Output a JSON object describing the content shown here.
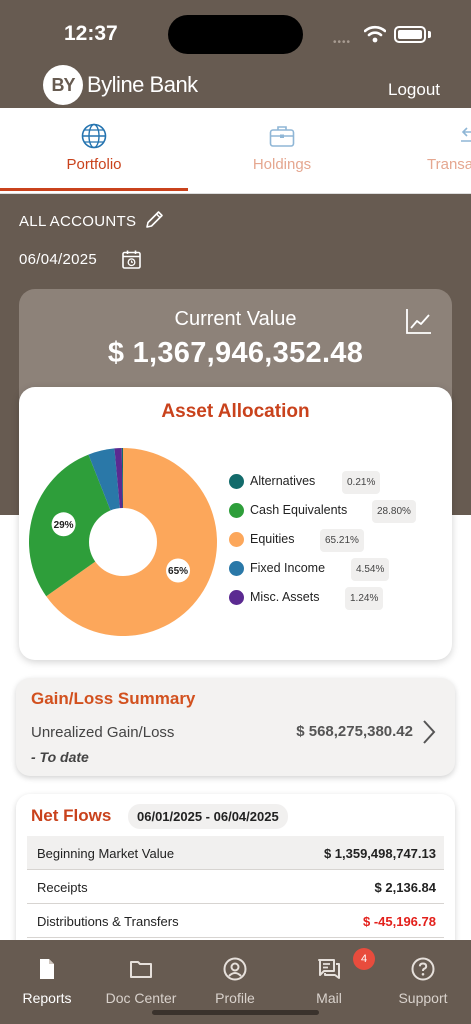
{
  "status_bar": {
    "time": "12:37"
  },
  "header": {
    "brand_logo": "BY",
    "brand_name": "Byline Bank",
    "logout_label": "Logout"
  },
  "tabs": [
    {
      "label": "Portfolio",
      "icon": "globe-icon",
      "active": true
    },
    {
      "label": "Holdings",
      "icon": "briefcase-icon",
      "active": false
    },
    {
      "label": "Transa",
      "icon": "transfer-arrows-icon",
      "active": false
    }
  ],
  "filters": {
    "accounts_label": "ALL ACCOUNTS",
    "date": "06/04/2025"
  },
  "current_value": {
    "title": "Current Value",
    "amount": "$ 1,367,946,352.48"
  },
  "asset_allocation": {
    "title": "Asset Allocation",
    "legend": [
      {
        "label": "Alternatives",
        "percent": "0.21%",
        "color": "#136b6b"
      },
      {
        "label": "Cash Equivalents",
        "percent": "28.80%",
        "color": "#2e9e3a"
      },
      {
        "label": "Equities",
        "percent": "65.21%",
        "color": "#fca75b"
      },
      {
        "label": "Fixed Income",
        "percent": "4.54%",
        "color": "#2a78a8"
      },
      {
        "label": "Misc. Assets",
        "percent": "1.24%",
        "color": "#5b2a91"
      }
    ],
    "slice_labels": {
      "cash": "29%",
      "equities": "65%"
    }
  },
  "chart_data": {
    "type": "pie",
    "title": "Asset Allocation",
    "categories": [
      "Alternatives",
      "Cash Equivalents",
      "Equities",
      "Fixed Income",
      "Misc. Assets"
    ],
    "values": [
      0.21,
      28.8,
      65.21,
      4.54,
      1.24
    ],
    "colors": [
      "#136b6b",
      "#2e9e3a",
      "#fca75b",
      "#2a78a8",
      "#5b2a91"
    ],
    "donut": true,
    "legend": "right"
  },
  "gain_loss": {
    "title": "Gain/Loss Summary",
    "label": "Unrealized Gain/Loss",
    "value": "$ 568,275,380.42",
    "subtitle": "- To date"
  },
  "net_flows": {
    "title": "Net Flows",
    "date_range": "06/01/2025 - 06/04/2025",
    "rows": [
      {
        "label": "Beginning Market Value",
        "value": "$ 1,359,498,747.13",
        "negative": false
      },
      {
        "label": "Receipts",
        "value": "$ 2,136.84",
        "negative": false
      },
      {
        "label": "Distributions & Transfers",
        "value": "$ -45,196.78",
        "negative": true
      }
    ]
  },
  "bottom_nav": [
    {
      "label": "Reports",
      "icon": "document-icon",
      "active": true
    },
    {
      "label": "Doc Center",
      "icon": "folder-icon",
      "active": false
    },
    {
      "label": "Profile",
      "icon": "person-icon",
      "active": false
    },
    {
      "label": "Mail",
      "icon": "mail-icon",
      "active": false,
      "badge": "4"
    },
    {
      "label": "Support",
      "icon": "help-icon",
      "active": false
    }
  ]
}
